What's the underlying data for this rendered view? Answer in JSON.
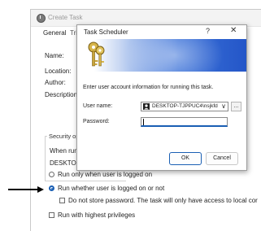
{
  "create_task": {
    "title": "Create Task",
    "tabs": [
      "General",
      "Tri"
    ],
    "labels": {
      "name": "Name:",
      "location": "Location:",
      "author": "Author:",
      "description": "Description"
    },
    "security": {
      "legend": "Security op",
      "when_running": "When run",
      "account": "DESKTOP-",
      "options": {
        "run_logged_on": "Run only when user is logged on",
        "run_logged_or_not": "Run whether user is logged on or not",
        "no_store_password": "Do not store password.  The task will only have access to local cor",
        "highest_privileges": "Run with highest privileges"
      },
      "selected": "run_logged_or_not"
    }
  },
  "dialog": {
    "title": "Task Scheduler",
    "help_glyph": "?",
    "close_glyph": "✕",
    "instruction": "Enter user account information for running this task.",
    "user_name_label": "User name:",
    "user_name_value": "DESKTOP-TJPPUC4\\nsjkfdl",
    "chevron": "∨",
    "browse_label": "...",
    "password_label": "Password:",
    "password_value": "",
    "ok_label": "OK",
    "cancel_label": "Cancel"
  },
  "colors": {
    "accent": "#1a5fb4",
    "banner_blue": "#2456c8"
  }
}
